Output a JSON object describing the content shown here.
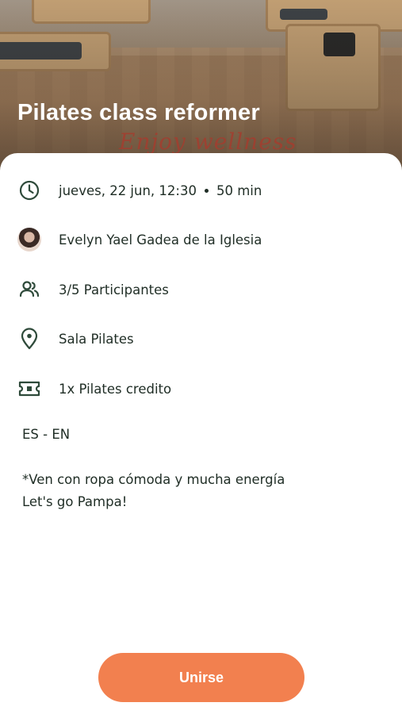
{
  "class": {
    "title": "Pilates class reformer",
    "hero_script_text": "Enjoy wellness"
  },
  "details": {
    "datetime": "jueves, 22 jun, 12:30",
    "duration": "50 min",
    "instructor": "Evelyn Yael Gadea de la Iglesia",
    "participants": "3/5 Participantes",
    "room": "Sala Pilates",
    "credit": "1x Pilates credito"
  },
  "languages": "ES - EN",
  "notes": {
    "line1": "*Ven con ropa cómoda y mucha energía",
    "line2": "Let's go Pampa!"
  },
  "actions": {
    "join_label": "Unirse"
  },
  "colors": {
    "accent": "#f2804f",
    "text": "#1f2d25",
    "icon": "#2e4a3a"
  },
  "icons": [
    "clock-icon",
    "avatar",
    "people-icon",
    "location-pin-icon",
    "ticket-icon"
  ]
}
